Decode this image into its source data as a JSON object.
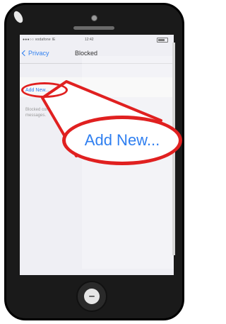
{
  "status_bar": {
    "carrier": "●●●○○ vodafone IE",
    "time": "12:42"
  },
  "nav": {
    "back_label": "Privacy",
    "title": "Blocked"
  },
  "content": {
    "add_new_label": "Add New...",
    "footer_text": "Blocked contacts will not be able to call you or send you messages."
  },
  "callout": {
    "label": "Add New..."
  },
  "colors": {
    "accent": "#2f7ff0",
    "highlight": "#e02020",
    "background": "#efeff4"
  }
}
